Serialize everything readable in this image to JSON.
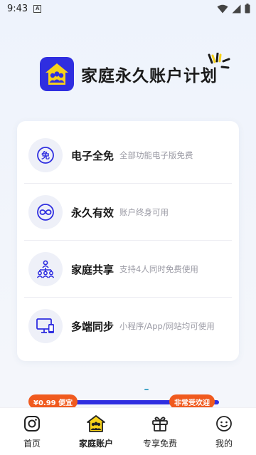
{
  "status_bar": {
    "time": "9:43",
    "notification_badge": "A",
    "icons": [
      "wifi-icon",
      "signal-icon",
      "battery-icon"
    ]
  },
  "hero": {
    "title": "家庭永久账户计划",
    "logo_icon": "family-house-icon",
    "accent_color": "#2f2ee0",
    "highlight_color": "#f7d21a"
  },
  "features": [
    {
      "icon": "free-icon",
      "icon_text": "免",
      "title": "电子全免",
      "desc": "全部功能电子版免费"
    },
    {
      "icon": "infinity-icon",
      "title": "永久有效",
      "desc": "账户终身可用"
    },
    {
      "icon": "family-share-icon",
      "title": "家庭共享",
      "desc": "支持4人同时免费使用"
    },
    {
      "icon": "multi-device-icon",
      "title": "多端同步",
      "desc": "小程序/App/网站均可使用"
    }
  ],
  "promo": {
    "price_tag": "¥0.99 便宜",
    "popular_tag": "非常受欢迎",
    "tag_color": "#f05a1e"
  },
  "bottom_nav": [
    {
      "icon": "instagram-camera-icon",
      "label": "首页",
      "active": false
    },
    {
      "icon": "family-house-icon",
      "label": "家庭账户",
      "active": true
    },
    {
      "icon": "gift-icon",
      "label": "专享免费",
      "active": false
    },
    {
      "icon": "smiley-icon",
      "label": "我的",
      "active": false
    }
  ]
}
